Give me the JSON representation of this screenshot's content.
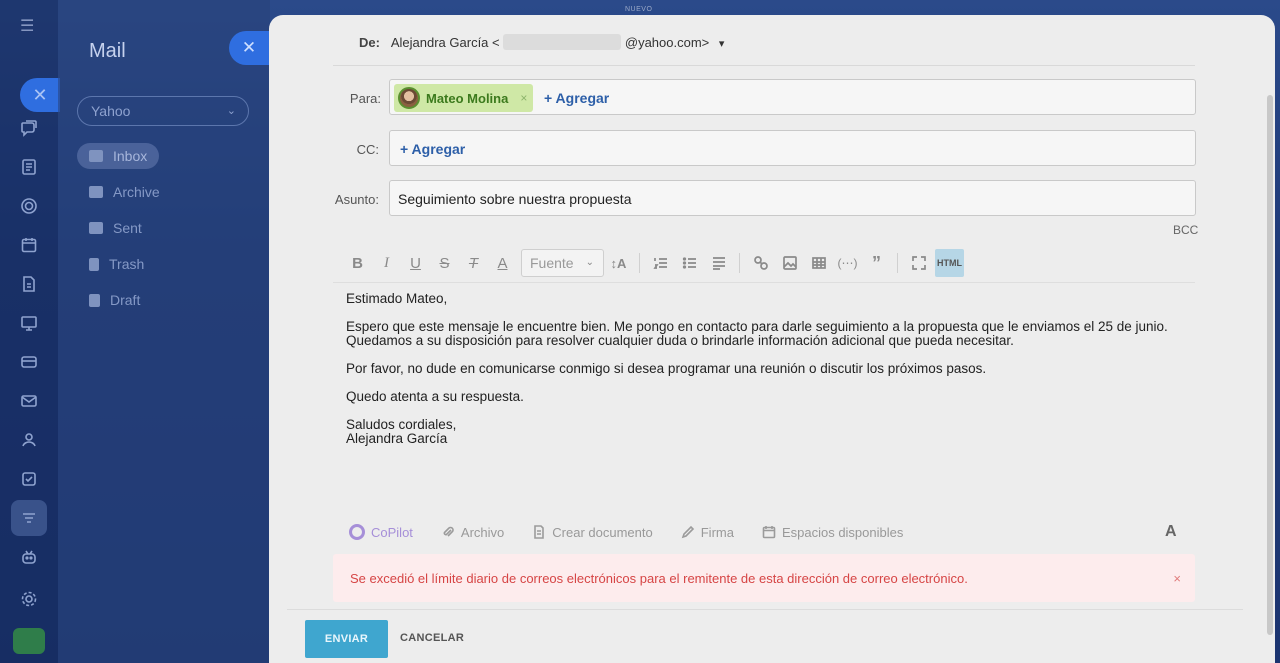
{
  "sidebar": {
    "icons": [
      "hamburger-icon",
      "close-icon",
      "chat-icon",
      "tasks-icon",
      "target-icon",
      "calendar-icon",
      "document-icon",
      "board-icon",
      "card-icon",
      "mail-icon",
      "contacts-icon",
      "checkbox-icon",
      "filter-icon",
      "robot-icon",
      "settings-icon",
      "rocket-icon"
    ]
  },
  "mail_panel": {
    "title": "Mail",
    "account": "Yahoo",
    "folders": [
      {
        "label": "Inbox",
        "icon": "inbox-icon",
        "active": true
      },
      {
        "label": "Archive",
        "icon": "archive-icon",
        "active": false
      },
      {
        "label": "Sent",
        "icon": "sent-icon",
        "active": false
      },
      {
        "label": "Trash",
        "icon": "trash-icon",
        "active": false
      },
      {
        "label": "Draft",
        "icon": "draft-icon",
        "active": false
      }
    ]
  },
  "top": {
    "badge": "NUEVO"
  },
  "compose": {
    "from_label": "De:",
    "from_name": "Alejandra García <",
    "from_domain": "@yahoo.com>",
    "to_label": "Para:",
    "recipient": "Mateo Molina",
    "add_label": "+ Agregar",
    "cc_label": "CC:",
    "subject_label": "Asunto:",
    "subject": "Seguimiento sobre nuestra propuesta",
    "bcc_label": "BCC",
    "font_label": "Fuente",
    "html_label": "HTML",
    "body": {
      "greeting": "Estimado Mateo,",
      "p1_line1": "Espero que este mensaje le encuentre bien. Me pongo en contacto para darle seguimiento a la propuesta que le enviamos el 25 de junio.",
      "p1_line2": "Quedamos a su disposición para resolver cualquier duda o brindarle información adicional que pueda necesitar.",
      "p2": "Por favor, no dude en comunicarse conmigo si desea programar una reunión o discutir los próximos pasos.",
      "p3": "Quedo atenta a su respuesta.",
      "closing": "Saludos cordiales,",
      "signature": "Alejandra García"
    },
    "tools": {
      "copilot": "CoPilot",
      "file": "Archivo",
      "create_doc": "Crear documento",
      "signature": "Firma",
      "slots": "Espacios disponibles",
      "format": "A"
    },
    "error": "Se excedió el límite diario de correos electrónicos para el remitente de esta dirección de correo electrónico.",
    "error_close": "×",
    "send": "ENVIAR",
    "cancel": "CANCELAR"
  },
  "colors": {
    "accent": "#2f6ee0",
    "send_button": "#3fa6cf",
    "recipient_chip": "#cfe8a6",
    "error_text": "#d64545",
    "error_bg": "#fdeced",
    "copilot": "#a68fd8"
  }
}
